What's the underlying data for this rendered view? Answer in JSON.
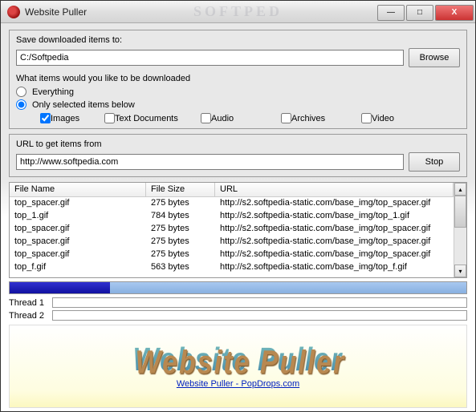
{
  "window": {
    "title": "Website Puller",
    "watermark": "SOFTPED"
  },
  "save_group": {
    "label": "Save downloaded items to:",
    "path": "C:/Softpedia",
    "browse": "Browse"
  },
  "items_group": {
    "prompt": "What items would you like to be downloaded",
    "opt_everything": "Everything",
    "opt_selected": "Only selected items below",
    "chk_images": "Images",
    "chk_text": "Text Documents",
    "chk_audio": "Audio",
    "chk_archives": "Archives",
    "chk_video": "Video"
  },
  "url_group": {
    "label": "URL to get items from",
    "url": "http://www.softpedia.com",
    "stop": "Stop"
  },
  "table": {
    "headers": {
      "c1": "File Name",
      "c2": "File Size",
      "c3": "URL"
    },
    "rows": [
      {
        "name": "top_spacer.gif",
        "size": "275 bytes",
        "url": "http://s2.softpedia-static.com/base_img/top_spacer.gif"
      },
      {
        "name": "top_1.gif",
        "size": "784 bytes",
        "url": "http://s2.softpedia-static.com/base_img/top_1.gif"
      },
      {
        "name": "top_spacer.gif",
        "size": "275 bytes",
        "url": "http://s2.softpedia-static.com/base_img/top_spacer.gif"
      },
      {
        "name": "top_spacer.gif",
        "size": "275 bytes",
        "url": "http://s2.softpedia-static.com/base_img/top_spacer.gif"
      },
      {
        "name": "top_spacer.gif",
        "size": "275 bytes",
        "url": "http://s2.softpedia-static.com/base_img/top_spacer.gif"
      },
      {
        "name": "top_f.gif",
        "size": "563 bytes",
        "url": "http://s2.softpedia-static.com/base_img/top_f.gif"
      }
    ]
  },
  "threads": {
    "t1": "Thread 1",
    "t2": "Thread 2"
  },
  "banner": {
    "logo": "Website Puller",
    "link": "Website Puller - PopDrops.com"
  }
}
